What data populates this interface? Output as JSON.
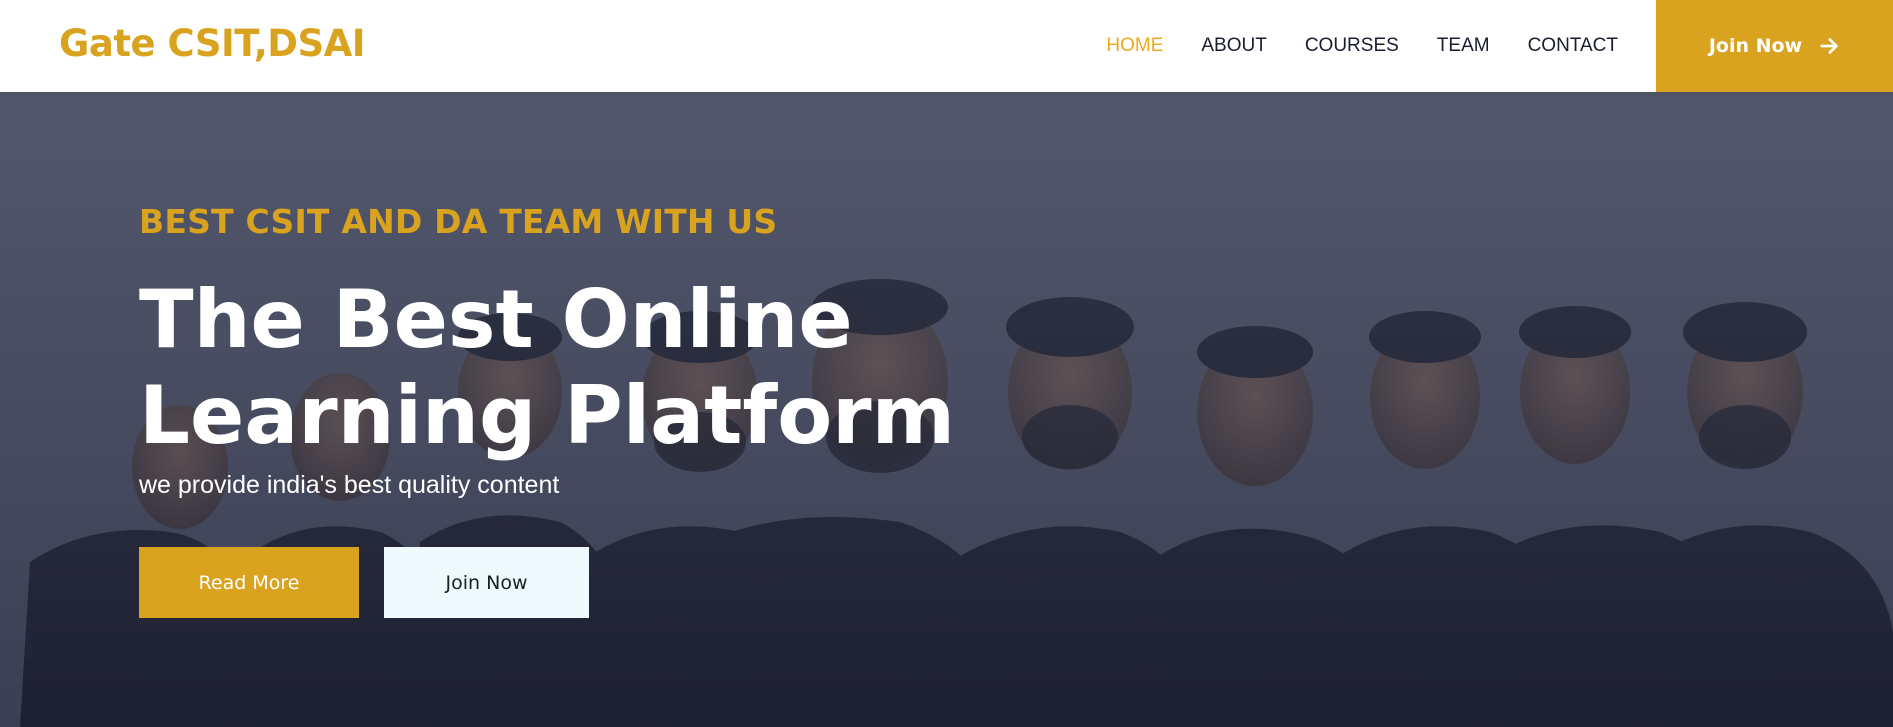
{
  "brand": {
    "name": "Gate CSIT,DSAI"
  },
  "nav": {
    "items": [
      {
        "label": "HOME",
        "active": true
      },
      {
        "label": "ABOUT",
        "active": false
      },
      {
        "label": "COURSES",
        "active": false
      },
      {
        "label": "TEAM",
        "active": false
      },
      {
        "label": "CONTACT",
        "active": false
      }
    ],
    "cta_label": "Join Now",
    "cta_icon": "arrow-right-icon"
  },
  "hero": {
    "eyebrow": "BEST CSIT AND DA TEAM WITH US",
    "headline": "The Best Online Learning Platform",
    "subtext": "we provide india's best quality content",
    "primary_button": "Read More",
    "secondary_button": "Join Now"
  },
  "colors": {
    "accent": "#d9a21f",
    "nav_active": "#f0a81b",
    "nav_text": "#1a1d2e",
    "hero_overlay": "#3a3f55",
    "secondary_button_bg": "#eefafb"
  }
}
